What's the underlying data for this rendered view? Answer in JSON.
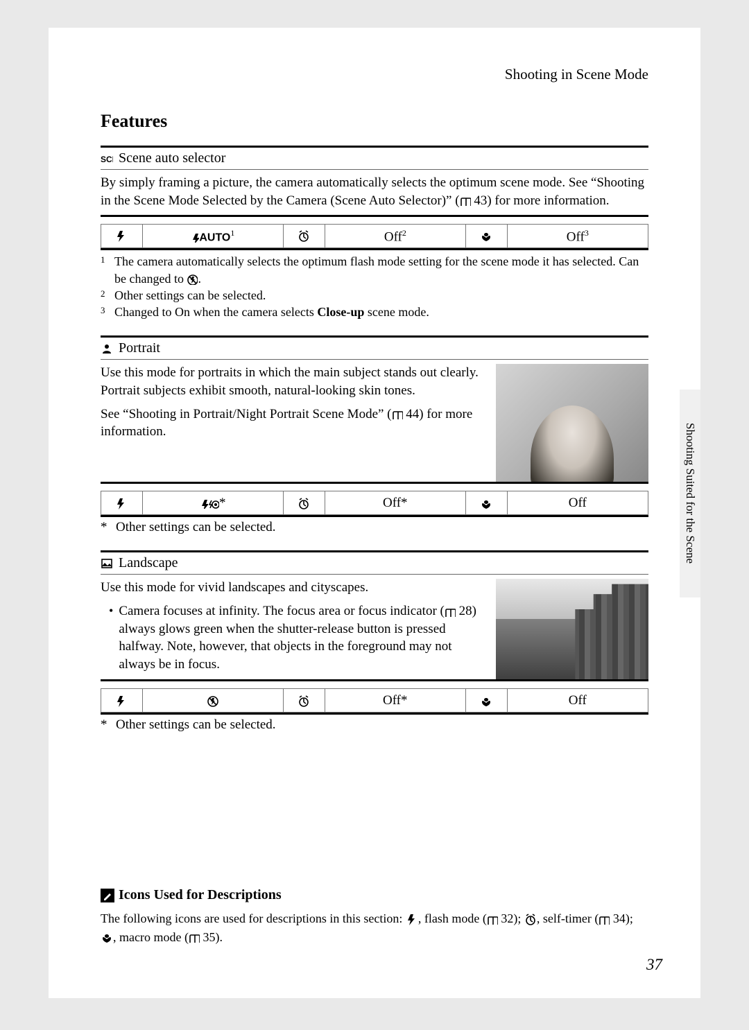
{
  "header": "Shooting in Scene Mode",
  "title": "Features",
  "side_tab": "Shooting Suited for the Scene",
  "page_num": "37",
  "icons": {
    "flash": "flash-icon",
    "timer": "self-timer-icon",
    "macro": "macro-icon",
    "book": "page-ref-icon",
    "scene_auto": "scene-auto-icon",
    "portrait": "portrait-icon",
    "landscape": "landscape-icon",
    "flash_off": "flash-off-icon",
    "auto_label": "꞉AUTO",
    "red_eye": "red-eye-icon"
  },
  "scene_auto": {
    "title": "Scene auto selector",
    "body1": "By simply framing a picture, the camera automatically selects the optimum scene mode. See “Shooting in the Scene Mode Selected by the Camera (Scene Auto Selector)” (",
    "body2": " 43) for more information.",
    "table": {
      "flash_val": "꞉AUTO",
      "flash_sup": "1",
      "timer_val": "Off",
      "timer_sup": "2",
      "macro_val": "Off",
      "macro_sup": "3"
    },
    "footnotes": {
      "n1": "1",
      "t1a": "The camera automatically selects the optimum flash mode setting for the scene mode it has selected. Can be changed to ",
      "t1b": ".",
      "n2": "2",
      "t2": "Other settings can be selected.",
      "n3": "3",
      "t3a": "Changed to On when the camera selects ",
      "t3b": "Close-up",
      "t3c": " scene mode."
    }
  },
  "portrait": {
    "title": "Portrait",
    "body1": "Use this mode for portraits in which the main subject stands out clearly. Portrait subjects exhibit smooth, natural-looking skin tones.",
    "body2a": "See “Shooting in Portrait/Night Portrait Scene Mode” (",
    "body2b": " 44) for more information.",
    "table": {
      "flash_val": "꞉",
      "flash_suffix": "*",
      "timer_val": "Off*",
      "macro_val": "Off"
    },
    "note": "Other settings can be selected."
  },
  "landscape": {
    "title": "Landscape",
    "body1": "Use this mode for vivid landscapes and cityscapes.",
    "bullet_a": "Camera focuses at infinity. The focus area or focus indicator (",
    "bullet_b": " 28) always glows green when the shutter-release button is pressed halfway. Note, however, that objects in the foreground may not always be in focus.",
    "table": {
      "timer_val": "Off*",
      "macro_val": "Off"
    },
    "note": "Other settings can be selected."
  },
  "info": {
    "title": "Icons Used for Descriptions",
    "p1": "The following icons are used for descriptions in this section: ",
    "p2": ", flash mode (",
    "p3": " 32); ",
    "p4": ", self-timer (",
    "p5": " 34); ",
    "p6": ", macro mode (",
    "p7": " 35)."
  }
}
